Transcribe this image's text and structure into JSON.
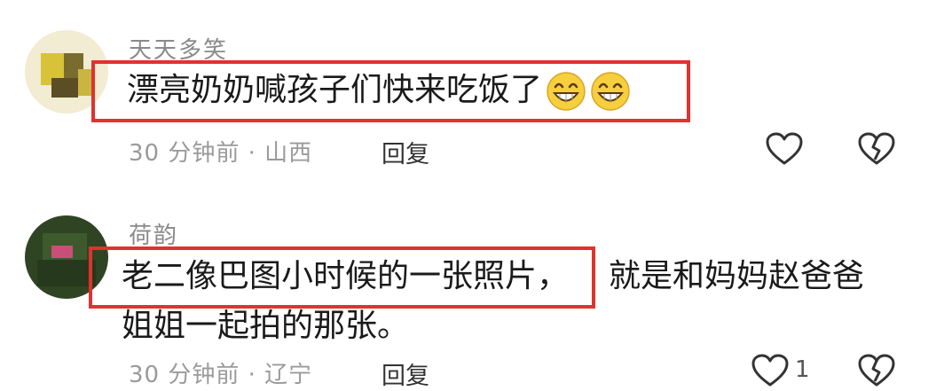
{
  "comments": [
    {
      "username": "天天多笑",
      "text": "漂亮奶奶喊孩子们快来吃饭了",
      "emoji": [
        "grinning-face",
        "grinning-face"
      ],
      "time": "30 分钟前",
      "location": "山西",
      "reply_label": "回复",
      "highlight_color": "#e0322f"
    },
    {
      "username": "荷韵",
      "text_highlighted": "老二像巴图小时候的一张照片，",
      "text_rest_line1": "就是和妈妈赵爸爸",
      "text_rest_line2": "姐姐一起拍的那张。",
      "time": "30 分钟前",
      "location": "辽宁",
      "reply_label": "回复",
      "like_count": "1",
      "highlight_color": "#e0322f"
    }
  ],
  "meta_separator": "·"
}
